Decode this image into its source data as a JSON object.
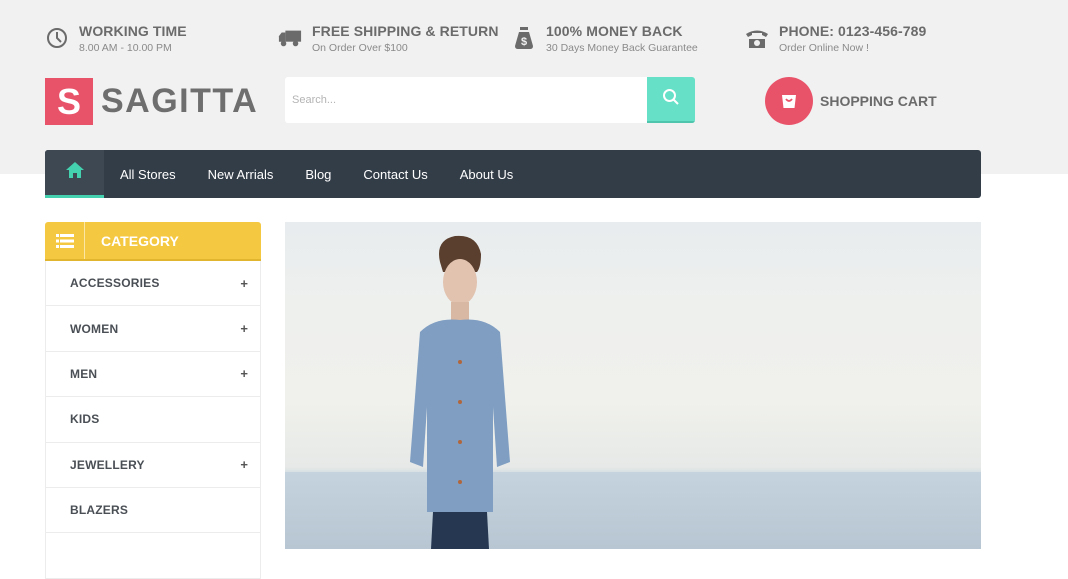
{
  "info_bar": [
    {
      "icon": "clock-icon",
      "title": "WORKING TIME",
      "subtitle": "8.00 AM - 10.00 PM"
    },
    {
      "icon": "truck-icon",
      "title": "FREE SHIPPING & RETURN",
      "subtitle": "On Order Over $100"
    },
    {
      "icon": "money-bag-icon",
      "title": "100% MONEY BACK",
      "subtitle": "30 Days Money Back Guarantee"
    },
    {
      "icon": "phone-icon",
      "title": "PHONE: 0123-456-789",
      "subtitle": "Order Online Now !"
    }
  ],
  "logo": {
    "letter": "S",
    "text": "SAGITTA"
  },
  "search": {
    "placeholder": "Search...",
    "value": ""
  },
  "cart": {
    "label": "SHOPPING CART"
  },
  "nav": {
    "links": [
      "All Stores",
      "New Arrials",
      "Blog",
      "Contact Us",
      "About Us"
    ]
  },
  "category": {
    "title": "CATEGORY",
    "items": [
      {
        "label": "ACCESSORIES",
        "expandable": "+"
      },
      {
        "label": "WOMEN",
        "expandable": "+"
      },
      {
        "label": "MEN",
        "expandable": "+"
      },
      {
        "label": "KIDS",
        "expandable": ""
      },
      {
        "label": "JEWELLERY",
        "expandable": "+"
      },
      {
        "label": "BLAZERS",
        "expandable": ""
      }
    ]
  },
  "colors": {
    "brand_pink": "#e9536a",
    "accent_teal": "#66e0c7",
    "nav_dark": "#333d48",
    "category_yellow": "#f5c842"
  }
}
